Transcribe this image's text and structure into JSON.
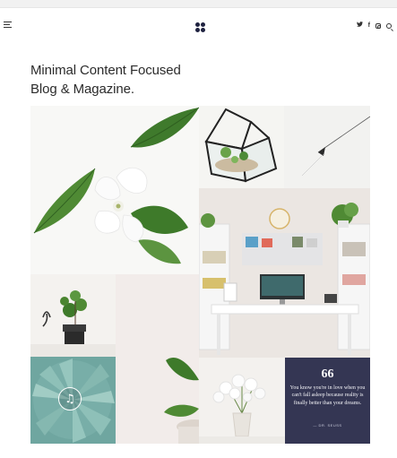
{
  "header": {
    "menu_icon": "menu-icon",
    "logo_icon": "four-dots-logo-icon",
    "social": [
      "twitter-icon",
      "facebook-icon",
      "instagram-icon",
      "search-icon"
    ]
  },
  "hero": {
    "headline_line1": "Minimal Content Focused",
    "headline_line2": "Blog & Magazine."
  },
  "gallery": {
    "quote": {
      "mark": "66",
      "text": "You know you're in love when you can't fall asleep because reality is finally better than your dreams.",
      "author": "— DR. SEUSS"
    },
    "music_icon": "music-note-icon"
  },
  "colors": {
    "quote_bg": "#343653",
    "logo": "#1f2240",
    "succulent": "#6fa6a0"
  }
}
